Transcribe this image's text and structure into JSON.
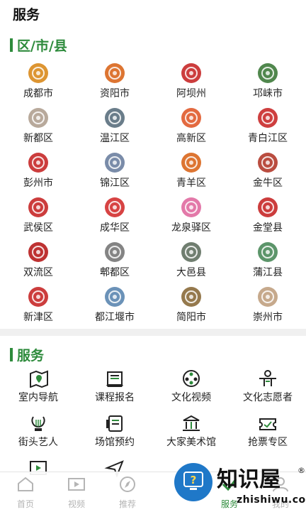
{
  "page_title": "服务",
  "districts_section": {
    "title": "区/市/县"
  },
  "districts": [
    {
      "name": "成都市",
      "icon": "chengdu-icon",
      "color": "#d98a1c"
    },
    {
      "name": "资阳市",
      "icon": "ziyang-icon",
      "color": "#d9661c"
    },
    {
      "name": "阿坝州",
      "icon": "aba-icon",
      "color": "#c62828"
    },
    {
      "name": "邛崃市",
      "icon": "qionglai-icon",
      "color": "#3d7a3a"
    },
    {
      "name": "新都区",
      "icon": "xindu-icon",
      "color": "#b0a090"
    },
    {
      "name": "温江区",
      "icon": "wenjiang-icon",
      "color": "#5a6f7d"
    },
    {
      "name": "高新区",
      "icon": "gaoxin-icon",
      "color": "#e05a2b"
    },
    {
      "name": "青白江区",
      "icon": "qingbaijiang-icon",
      "color": "#c92a2a"
    },
    {
      "name": "彭州市",
      "icon": "pengzhou-icon",
      "color": "#c62828"
    },
    {
      "name": "锦江区",
      "icon": "jinjiang-icon",
      "color": "#6b7fa0"
    },
    {
      "name": "青羊区",
      "icon": "qingyang-icon",
      "color": "#d9661c"
    },
    {
      "name": "金牛区",
      "icon": "jinniu-icon",
      "color": "#b23a2b"
    },
    {
      "name": "武侯区",
      "icon": "wuhou-icon",
      "color": "#c62828"
    },
    {
      "name": "成华区",
      "icon": "chenghua-icon",
      "color": "#d32f2f"
    },
    {
      "name": "龙泉驿区",
      "icon": "longquanyi-icon",
      "color": "#e06aa0"
    },
    {
      "name": "金堂县",
      "icon": "jintang-icon",
      "color": "#c62828"
    },
    {
      "name": "双流区",
      "icon": "shuangliu-icon",
      "color": "#b71c1c"
    },
    {
      "name": "郫都区",
      "icon": "pidu-icon",
      "color": "#777777"
    },
    {
      "name": "大邑县",
      "icon": "dayi-icon",
      "color": "#607060"
    },
    {
      "name": "蒲江县",
      "icon": "pujiang-icon",
      "color": "#4a8a5a"
    },
    {
      "name": "新津区",
      "icon": "xinjin-icon",
      "color": "#c62828"
    },
    {
      "name": "都江堰市",
      "icon": "dujiangyan-icon",
      "color": "#5b86b0"
    },
    {
      "name": "简阳市",
      "icon": "jianyang-icon",
      "color": "#8a6a3a"
    },
    {
      "name": "崇州市",
      "icon": "chongzhou-icon",
      "color": "#c0a080"
    }
  ],
  "services_section": {
    "title": "服务"
  },
  "services": [
    {
      "name": "室内导航",
      "icon": "map-location-icon"
    },
    {
      "name": "课程报名",
      "icon": "course-register-icon"
    },
    {
      "name": "文化视频",
      "icon": "film-reel-icon"
    },
    {
      "name": "文化志愿者",
      "icon": "volunteer-icon"
    },
    {
      "name": "街头艺人",
      "icon": "lyre-icon"
    },
    {
      "name": "场馆预约",
      "icon": "venue-booking-icon"
    },
    {
      "name": "大家美术馆",
      "icon": "museum-icon"
    },
    {
      "name": "抢票专区",
      "icon": "ticket-icon"
    },
    {
      "name": "",
      "icon": "play-video-icon"
    },
    {
      "name": "",
      "icon": "send-icon"
    }
  ],
  "tabbar": [
    {
      "label": "首页",
      "icon": "home-icon",
      "active": false
    },
    {
      "label": "视频",
      "icon": "video-icon",
      "active": false
    },
    {
      "label": "推荐",
      "icon": "compass-icon",
      "active": false
    },
    {
      "label": "",
      "icon": "",
      "active": false
    },
    {
      "label": "服务",
      "icon": "service-icon",
      "active": true
    },
    {
      "label": "我的",
      "icon": "user-icon",
      "active": false
    }
  ],
  "watermark": {
    "brand": "知识屋",
    "url": "zhishiwu.com",
    "registered": "®"
  },
  "colors": {
    "accent": "#2e8b3c"
  }
}
